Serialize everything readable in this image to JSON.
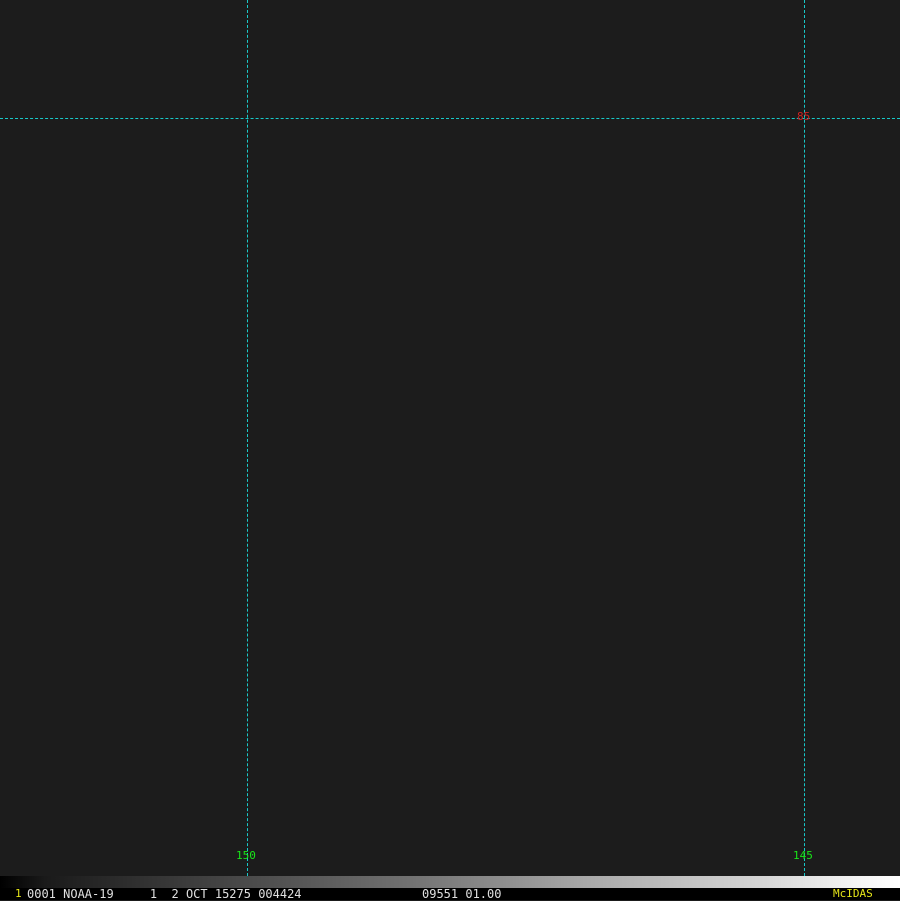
{
  "colors": {
    "background": "#1c1c1c",
    "grid_line": "#18c8c8",
    "longitude_label": "#19e619",
    "latitude_label": "#cc2222",
    "status_text": "#e0e0e0",
    "frame_number": "#e6e619",
    "brand": "#e6e619"
  },
  "map": {
    "longitude_lines": [
      {
        "label": "150"
      },
      {
        "label": "145"
      }
    ],
    "latitude_lines": [
      {
        "label": "85"
      }
    ]
  },
  "status_bar": {
    "frame_number": "1",
    "info_left": "0001 NOAA-19     1  2 OCT 15275 004424",
    "info_right": "09551 01.00",
    "brand": "McIDAS"
  }
}
